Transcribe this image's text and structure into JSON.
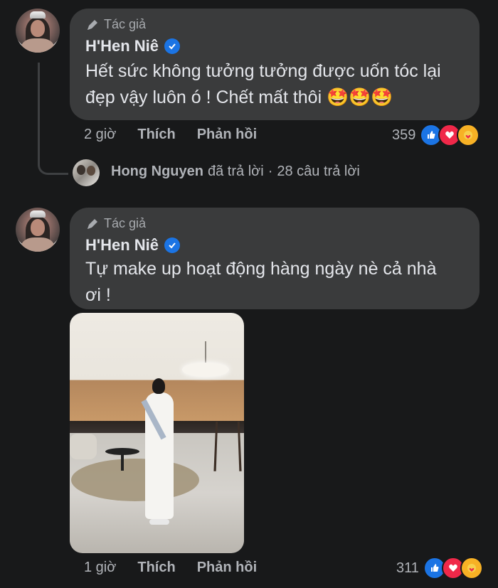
{
  "colors": {
    "background": "#18191a",
    "bubble": "#3a3b3c",
    "primary_text": "#e4e6eb",
    "secondary_text": "#b0b3b8",
    "verified": "#1b74e4",
    "like": "#1b74e4",
    "love": "#f02849",
    "care": "#f7b125"
  },
  "comments": [
    {
      "badge": "Tác giả",
      "author": "H'Hen Niê",
      "text_line1": "Hết sức không tưởng tưởng được uốn tóc lại",
      "text_line2": "đẹp vậy luôn ó ! Chết mất thôi 🤩🤩🤩",
      "time": "2 giờ",
      "like_label": "Thích",
      "reply_label": "Phản hồi",
      "reaction_count": "359",
      "reaction_icons": [
        "like-icon",
        "love-icon",
        "care-icon"
      ]
    },
    {
      "badge": "Tác giả",
      "author": "H'Hen Niê",
      "text_line1": "Tự make up hoạt động hàng ngày nè cả nhà",
      "text_line2": "ơi !",
      "time": "1 giờ",
      "like_label": "Thích",
      "reply_label": "Phản hồi",
      "reaction_count": "311",
      "reaction_icons": [
        "like-icon",
        "love-icon",
        "care-icon"
      ]
    }
  ],
  "reply_summary": {
    "name": "Hong Nguyen",
    "action": "đã trả lời",
    "separator": "·",
    "count_text": "28 câu trả lời"
  }
}
